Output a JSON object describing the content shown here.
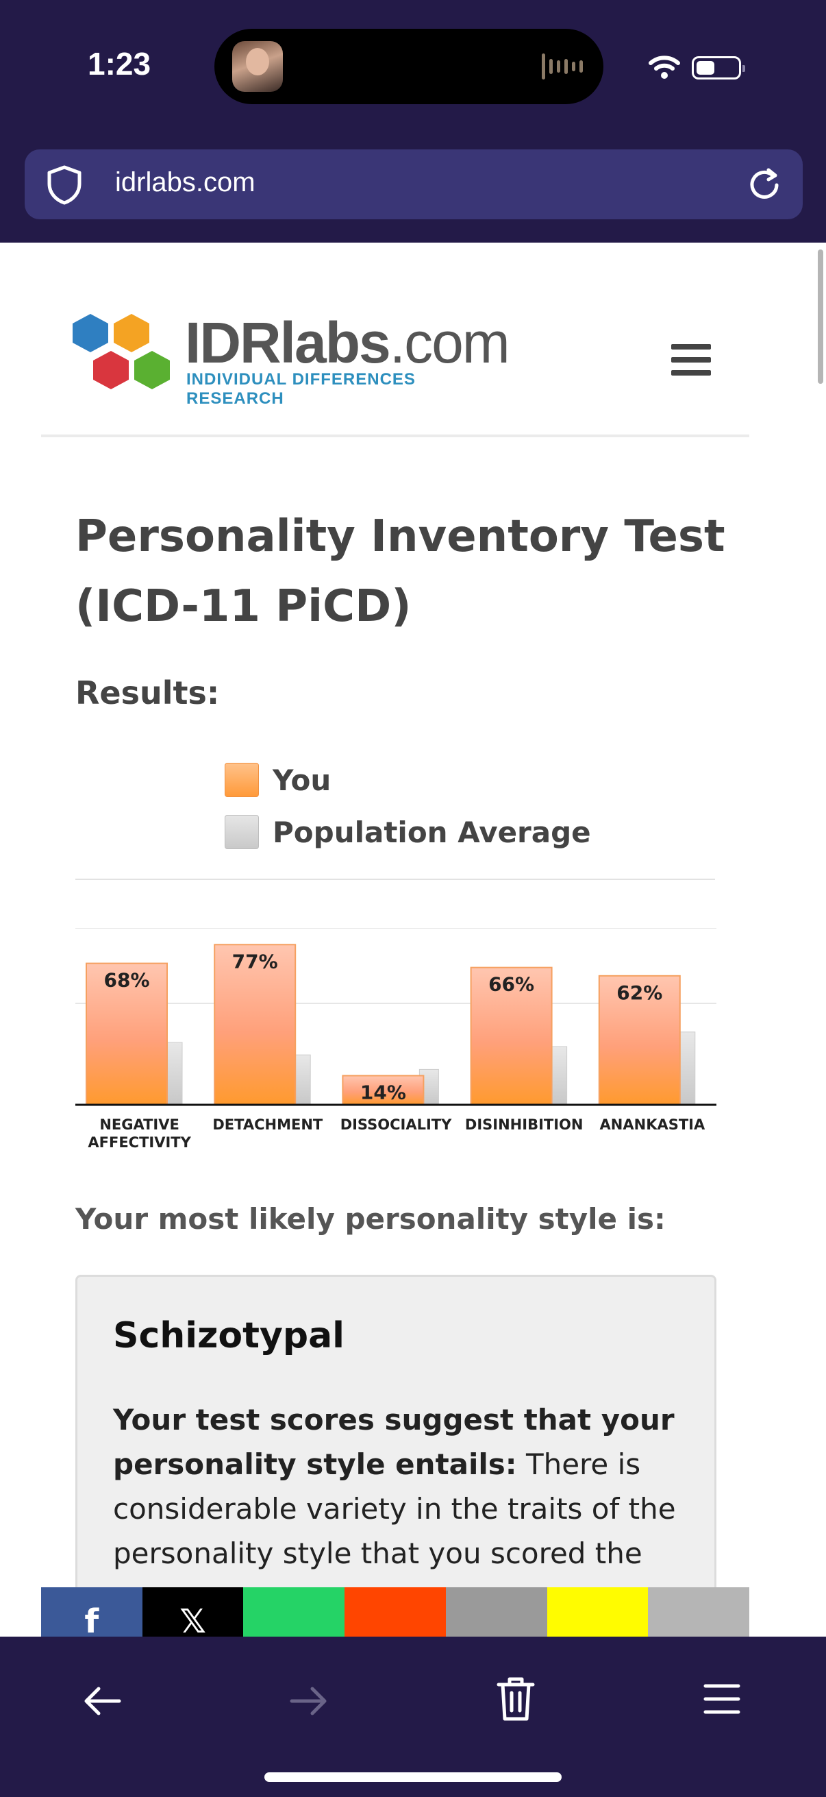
{
  "status_bar": {
    "time": "1:23"
  },
  "browser": {
    "url": "idrlabs.com"
  },
  "site": {
    "logo_main": "IDRlabs",
    "logo_suffix": ".com",
    "logo_subtitle": "INDIVIDUAL DIFFERENCES RESEARCH"
  },
  "page": {
    "title": "Personality Inventory Test (ICD-11 PiCD)",
    "results_label": "Results:",
    "legend": {
      "you": "You",
      "population": "Population Average"
    },
    "style_label": "Your most likely personality style is:",
    "result": {
      "title": "Schizotypal",
      "lead": "Your test scores suggest that your personality style entails:",
      "body": " There is considerable variety in the traits of the personality style that you scored the"
    }
  },
  "chart_data": {
    "type": "bar",
    "categories": [
      "NEGATIVE AFFECTIVITY",
      "DETACHMENT",
      "DISSOCIALITY",
      "DISINHIBITION",
      "ANANKASTIA"
    ],
    "category_lines": [
      [
        "NEGATIVE",
        "AFFECTIVITY"
      ],
      [
        "DETACHMENT"
      ],
      [
        "DISSOCIALITY"
      ],
      [
        "DISINHIBITION"
      ],
      [
        "ANANKASTIA"
      ]
    ],
    "series": [
      {
        "name": "You",
        "values": [
          68,
          77,
          14,
          66,
          62
        ],
        "labels": [
          "68%",
          "77%",
          "14%",
          "66%",
          "62%"
        ],
        "color": "#ff9a3a"
      },
      {
        "name": "Population Average",
        "values": [
          30,
          24,
          17,
          28,
          35
        ],
        "color": "#cfcfcf"
      }
    ],
    "ylim": [
      0,
      85
    ],
    "grid": true
  },
  "share": [
    {
      "name": "facebook",
      "color": "#3b5998",
      "glyph": "f"
    },
    {
      "name": "x",
      "color": "#000000",
      "glyph": "𝕏"
    },
    {
      "name": "whatsapp",
      "color": "#25d366",
      "glyph": ""
    },
    {
      "name": "reddit",
      "color": "#ff4500",
      "glyph": ""
    },
    {
      "name": "email",
      "color": "#9a9a9a",
      "glyph": ""
    },
    {
      "name": "snapchat",
      "color": "#fffc00",
      "glyph": ""
    },
    {
      "name": "copy-link",
      "color": "#b5b5b5",
      "glyph": ""
    }
  ]
}
